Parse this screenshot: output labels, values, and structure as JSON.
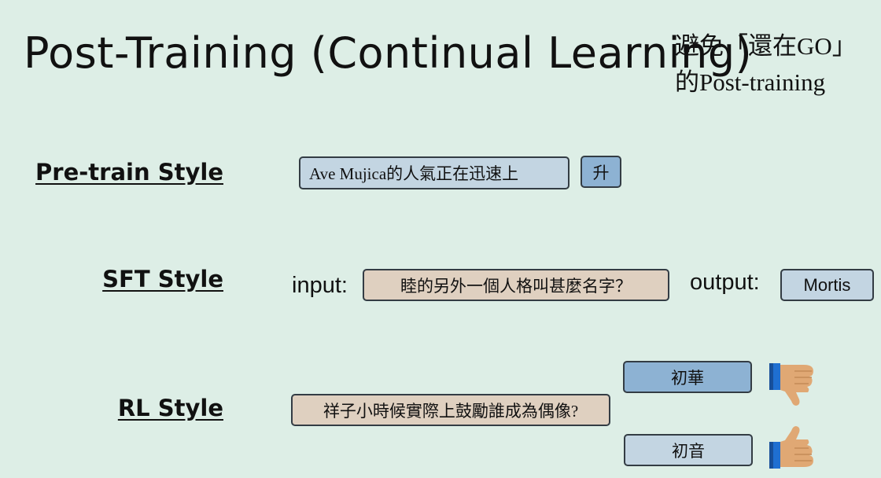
{
  "title": "Post-Training (Continual Learning)",
  "note": {
    "line1": "避免「還在GO」",
    "line2": "的Post-training"
  },
  "pretrain": {
    "label": "Pre-train Style",
    "text": "Ave Mujica的人氣正在迅速上",
    "next_token": "升"
  },
  "sft": {
    "label": "SFT Style",
    "input_label": "input:",
    "input_text": "睦的另外一個人格叫甚麼名字？",
    "output_label": "output:",
    "output_text": "Mortis"
  },
  "rl": {
    "label": "RL Style",
    "prompt": "祥子小時候實際上鼓勵誰成為偶像?",
    "bad_answer": "初華",
    "good_answer": "初音",
    "bad_icon": "thumbs-down-icon",
    "good_icon": "thumbs-up-icon"
  },
  "colors": {
    "background": "#ddeee6",
    "box_light_blue": "#c3d5e2",
    "box_blue": "#8db2d3",
    "box_tan": "#dfd0c0",
    "thumb_skin": "#e0a874",
    "thumb_cuff": "#1f6fd1"
  }
}
